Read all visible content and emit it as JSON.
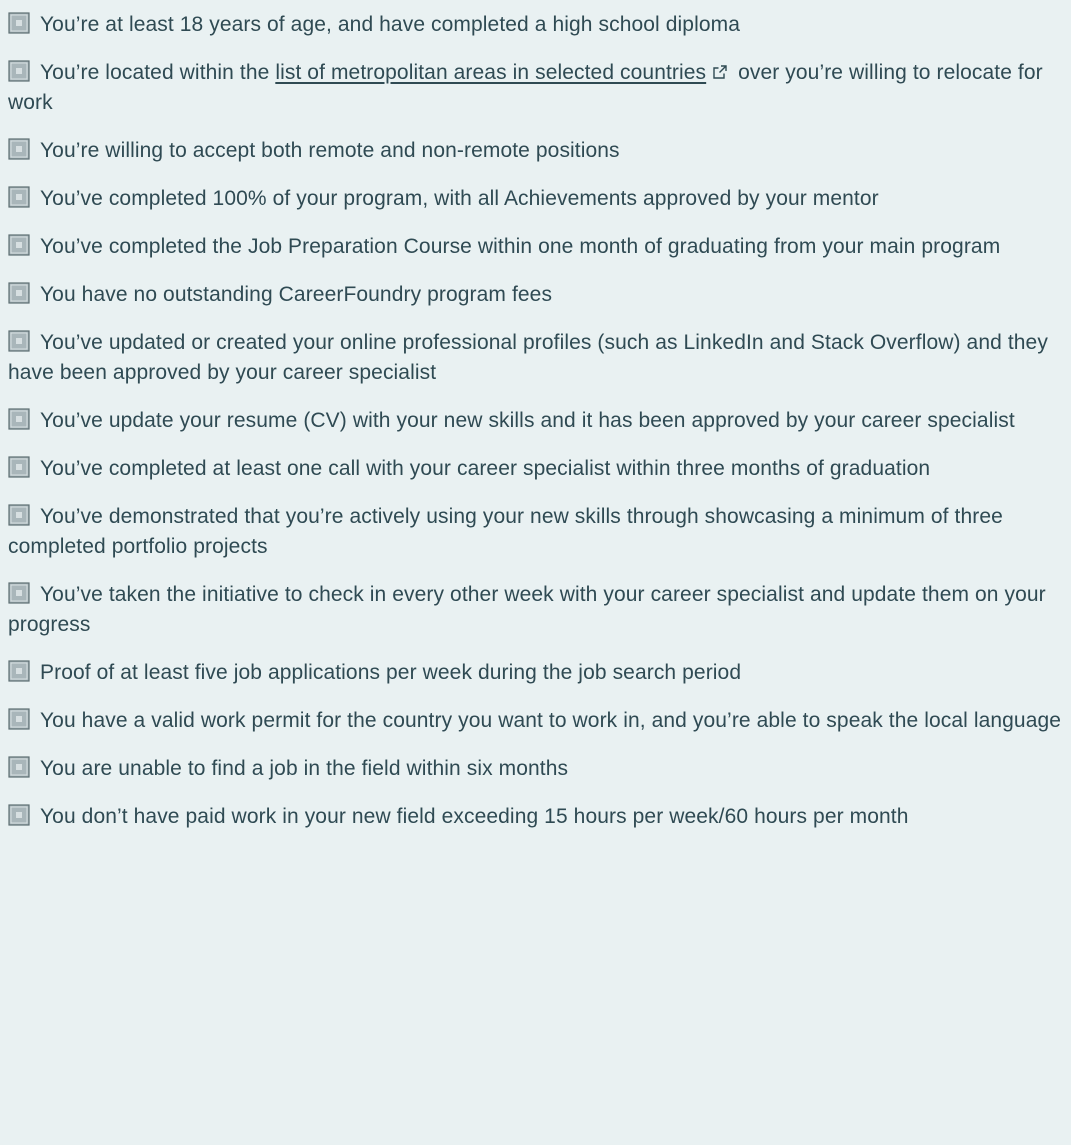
{
  "colors": {
    "background": "#e9f1f2",
    "text": "#2f4a53",
    "checkbox_fill": "#a9b6ba",
    "checkbox_border": "#5c6d72"
  },
  "icons": {
    "checkbox": "unchecked-checkbox-icon",
    "external_link": "external-link-icon"
  },
  "requirements": [
    {
      "text": "You’re at least 18 years of age, and have completed a high school diploma"
    },
    {
      "text_before": "You’re located within the ",
      "link_text": "list of metropolitan areas in selected countries",
      "text_after": " over you’re willing to relocate for work"
    },
    {
      "text": "You’re willing to accept both remote and non-remote positions"
    },
    {
      "text": "You’ve completed 100% of your program, with all Achievements approved by your mentor"
    },
    {
      "text": "You’ve completed the Job Preparation Course within one month of graduating from your main program"
    },
    {
      "text": "You have no outstanding CareerFoundry program fees"
    },
    {
      "text": "You’ve updated or created your online professional profiles (such as LinkedIn and Stack Overflow) and they have been approved by your career specialist"
    },
    {
      "text": "You’ve update your resume (CV) with your new skills and it has been approved by your career specialist"
    },
    {
      "text": "You’ve completed at least one call with your career specialist within three months of graduation"
    },
    {
      "text": "You’ve demonstrated that you’re actively using your new skills through showcasing a minimum of three completed portfolio projects"
    },
    {
      "text": "You’ve taken the initiative to check in every other week with your career specialist and update them on your progress"
    },
    {
      "text": "Proof of at least five job applications per week during the job search period"
    },
    {
      "text": "You have a valid work permit for the country you want to work in, and you’re able to speak the local language"
    },
    {
      "text": "You are unable to find a job in the field within six months"
    },
    {
      "text": "You don’t have paid work in your new field exceeding 15 hours per week/60 hours per month"
    }
  ]
}
